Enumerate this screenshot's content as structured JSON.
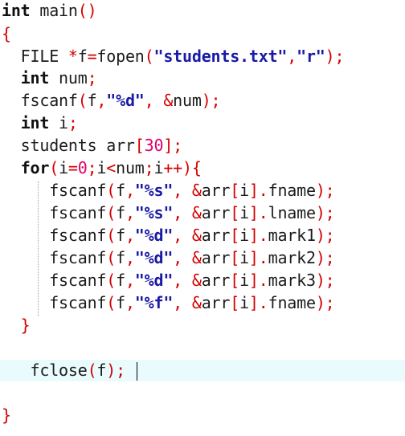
{
  "editor": {
    "language": "C",
    "colors": {
      "keyword": "#101010",
      "operator": "#d40000",
      "number": "#e0006a",
      "string": "#1a1aa6",
      "current_line_background": "#e9fbfd"
    },
    "lines": [
      [
        {
          "t": "int",
          "c": "kw"
        },
        {
          "t": " main",
          "c": "plain"
        },
        {
          "t": "()",
          "c": "op"
        }
      ],
      [
        {
          "t": "{",
          "c": "op"
        }
      ],
      [
        {
          "t": "  FILE ",
          "c": "plain"
        },
        {
          "t": "*",
          "c": "op"
        },
        {
          "t": "f",
          "c": "plain"
        },
        {
          "t": "=",
          "c": "op"
        },
        {
          "t": "fopen",
          "c": "plain"
        },
        {
          "t": "(",
          "c": "op"
        },
        {
          "t": "\"students.txt\"",
          "c": "str"
        },
        {
          "t": ",",
          "c": "op"
        },
        {
          "t": "\"r\"",
          "c": "str"
        },
        {
          "t": ");",
          "c": "op"
        }
      ],
      [
        {
          "t": "  ",
          "c": "plain"
        },
        {
          "t": "int",
          "c": "kw"
        },
        {
          "t": " num",
          "c": "plain"
        },
        {
          "t": ";",
          "c": "op"
        }
      ],
      [
        {
          "t": "  fscanf",
          "c": "plain"
        },
        {
          "t": "(",
          "c": "op"
        },
        {
          "t": "f",
          "c": "plain"
        },
        {
          "t": ",",
          "c": "op"
        },
        {
          "t": "\"%d\"",
          "c": "str"
        },
        {
          "t": ", ",
          "c": "op"
        },
        {
          "t": "&",
          "c": "op"
        },
        {
          "t": "num",
          "c": "plain"
        },
        {
          "t": ");",
          "c": "op"
        }
      ],
      [
        {
          "t": "  ",
          "c": "plain"
        },
        {
          "t": "int",
          "c": "kw"
        },
        {
          "t": " i",
          "c": "plain"
        },
        {
          "t": ";",
          "c": "op"
        }
      ],
      [
        {
          "t": "  students arr",
          "c": "plain"
        },
        {
          "t": "[",
          "c": "op"
        },
        {
          "t": "30",
          "c": "num"
        },
        {
          "t": "];",
          "c": "op"
        }
      ],
      [
        {
          "t": "  ",
          "c": "plain"
        },
        {
          "t": "for",
          "c": "kw"
        },
        {
          "t": "(",
          "c": "op"
        },
        {
          "t": "i",
          "c": "plain"
        },
        {
          "t": "=",
          "c": "op"
        },
        {
          "t": "0",
          "c": "num"
        },
        {
          "t": ";",
          "c": "op"
        },
        {
          "t": "i",
          "c": "plain"
        },
        {
          "t": "<",
          "c": "op"
        },
        {
          "t": "num",
          "c": "plain"
        },
        {
          "t": ";",
          "c": "op"
        },
        {
          "t": "i",
          "c": "plain"
        },
        {
          "t": "++",
          "c": "op"
        },
        {
          "t": "){",
          "c": "op"
        }
      ],
      [
        {
          "t": "     fscanf",
          "c": "plain"
        },
        {
          "t": "(",
          "c": "op"
        },
        {
          "t": "f",
          "c": "plain"
        },
        {
          "t": ",",
          "c": "op"
        },
        {
          "t": "\"%s\"",
          "c": "str"
        },
        {
          "t": ", ",
          "c": "op"
        },
        {
          "t": "&",
          "c": "op"
        },
        {
          "t": "arr",
          "c": "plain"
        },
        {
          "t": "[",
          "c": "op"
        },
        {
          "t": "i",
          "c": "plain"
        },
        {
          "t": "].",
          "c": "op"
        },
        {
          "t": "fname",
          "c": "plain"
        },
        {
          "t": ");",
          "c": "op"
        }
      ],
      [
        {
          "t": "     fscanf",
          "c": "plain"
        },
        {
          "t": "(",
          "c": "op"
        },
        {
          "t": "f",
          "c": "plain"
        },
        {
          "t": ",",
          "c": "op"
        },
        {
          "t": "\"%s\"",
          "c": "str"
        },
        {
          "t": ", ",
          "c": "op"
        },
        {
          "t": "&",
          "c": "op"
        },
        {
          "t": "arr",
          "c": "plain"
        },
        {
          "t": "[",
          "c": "op"
        },
        {
          "t": "i",
          "c": "plain"
        },
        {
          "t": "].",
          "c": "op"
        },
        {
          "t": "lname",
          "c": "plain"
        },
        {
          "t": ");",
          "c": "op"
        }
      ],
      [
        {
          "t": "     fscanf",
          "c": "plain"
        },
        {
          "t": "(",
          "c": "op"
        },
        {
          "t": "f",
          "c": "plain"
        },
        {
          "t": ",",
          "c": "op"
        },
        {
          "t": "\"%d\"",
          "c": "str"
        },
        {
          "t": ", ",
          "c": "op"
        },
        {
          "t": "&",
          "c": "op"
        },
        {
          "t": "arr",
          "c": "plain"
        },
        {
          "t": "[",
          "c": "op"
        },
        {
          "t": "i",
          "c": "plain"
        },
        {
          "t": "].",
          "c": "op"
        },
        {
          "t": "mark1",
          "c": "plain"
        },
        {
          "t": ");",
          "c": "op"
        }
      ],
      [
        {
          "t": "     fscanf",
          "c": "plain"
        },
        {
          "t": "(",
          "c": "op"
        },
        {
          "t": "f",
          "c": "plain"
        },
        {
          "t": ",",
          "c": "op"
        },
        {
          "t": "\"%d\"",
          "c": "str"
        },
        {
          "t": ", ",
          "c": "op"
        },
        {
          "t": "&",
          "c": "op"
        },
        {
          "t": "arr",
          "c": "plain"
        },
        {
          "t": "[",
          "c": "op"
        },
        {
          "t": "i",
          "c": "plain"
        },
        {
          "t": "].",
          "c": "op"
        },
        {
          "t": "mark2",
          "c": "plain"
        },
        {
          "t": ");",
          "c": "op"
        }
      ],
      [
        {
          "t": "     fscanf",
          "c": "plain"
        },
        {
          "t": "(",
          "c": "op"
        },
        {
          "t": "f",
          "c": "plain"
        },
        {
          "t": ",",
          "c": "op"
        },
        {
          "t": "\"%d\"",
          "c": "str"
        },
        {
          "t": ", ",
          "c": "op"
        },
        {
          "t": "&",
          "c": "op"
        },
        {
          "t": "arr",
          "c": "plain"
        },
        {
          "t": "[",
          "c": "op"
        },
        {
          "t": "i",
          "c": "plain"
        },
        {
          "t": "].",
          "c": "op"
        },
        {
          "t": "mark3",
          "c": "plain"
        },
        {
          "t": ");",
          "c": "op"
        }
      ],
      [
        {
          "t": "     fscanf",
          "c": "plain"
        },
        {
          "t": "(",
          "c": "op"
        },
        {
          "t": "f",
          "c": "plain"
        },
        {
          "t": ",",
          "c": "op"
        },
        {
          "t": "\"%f\"",
          "c": "str"
        },
        {
          "t": ", ",
          "c": "op"
        },
        {
          "t": "&",
          "c": "op"
        },
        {
          "t": "arr",
          "c": "plain"
        },
        {
          "t": "[",
          "c": "op"
        },
        {
          "t": "i",
          "c": "plain"
        },
        {
          "t": "].",
          "c": "op"
        },
        {
          "t": "fname",
          "c": "plain"
        },
        {
          "t": ");",
          "c": "op"
        }
      ],
      [
        {
          "t": "  }",
          "c": "op"
        }
      ],
      [],
      [
        {
          "t": "   fclose",
          "c": "plain"
        },
        {
          "t": "(",
          "c": "op"
        },
        {
          "t": "f",
          "c": "plain"
        },
        {
          "t": ");",
          "c": "op"
        }
      ],
      [],
      [],
      [
        {
          "t": "}",
          "c": "op"
        }
      ]
    ],
    "current_line": 16
  }
}
